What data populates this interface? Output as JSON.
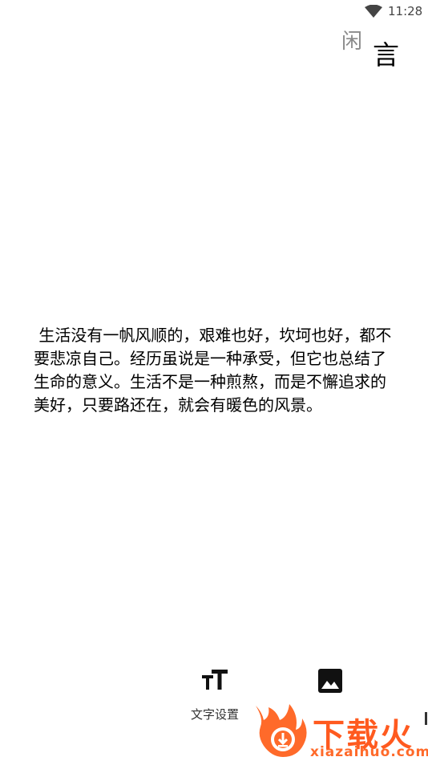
{
  "status_bar": {
    "time": "11:28",
    "icons": [
      "wifi-icon"
    ]
  },
  "app": {
    "logo_chars": [
      "闲",
      "言"
    ]
  },
  "quote": {
    "text": " 生活没有一帆风顺的，艰难也好，坎坷也好，都不要悲凉自己。经历虽说是一种承受，但它也总结了生命的意义。生活不是一种煎熬，而是不懈追求的美好，只要路还在，就会有暖色的风景。"
  },
  "toolbar": {
    "items": [
      {
        "label": "文字设置",
        "icon": "text-size-icon"
      },
      {
        "label": "",
        "icon": "image-icon"
      }
    ]
  },
  "watermark": {
    "title": "下载火",
    "url": "xiazaihuo.com"
  },
  "colors": {
    "background": "#ffffff",
    "text": "#000000",
    "watermark": "#ff5a1f"
  }
}
